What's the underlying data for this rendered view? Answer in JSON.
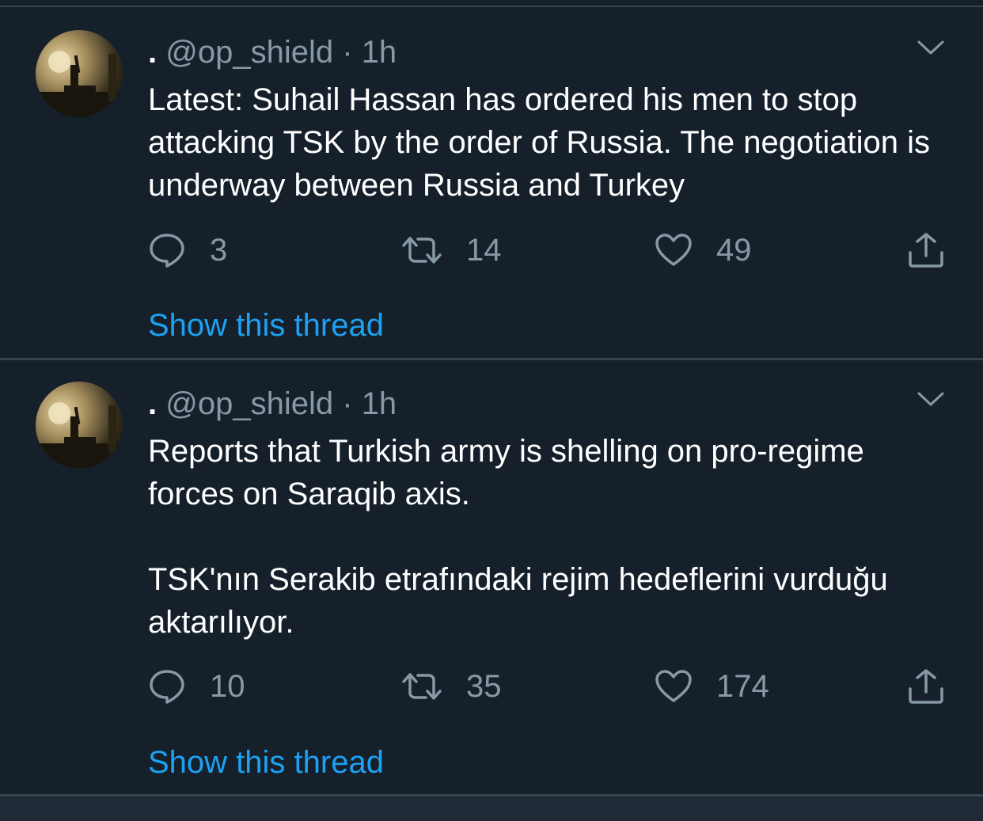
{
  "colors": {
    "background": "#15202b",
    "divider": "#38444d",
    "text": "#ffffff",
    "muted": "#8899a6",
    "link": "#1da1f2"
  },
  "tweets": [
    {
      "display_name": ".",
      "handle": "@op_shield",
      "separator": "·",
      "time": "1h",
      "text": [
        "Latest: Suhail Hassan has ordered his men to stop attacking TSK by the order of Russia. The negotiation is underway between Russia and Turkey"
      ],
      "replies": "3",
      "retweets": "14",
      "likes": "49",
      "show_thread": "Show this thread"
    },
    {
      "display_name": ".",
      "handle": "@op_shield",
      "separator": "·",
      "time": "1h",
      "text": [
        "Reports that Turkish army is shelling on pro-regime forces on Saraqib axis.",
        "TSK'nın Serakib etrafındaki rejim hedeflerini vurduğu aktarılıyor."
      ],
      "replies": "10",
      "retweets": "35",
      "likes": "174",
      "show_thread": "Show this thread"
    }
  ],
  "icons": {
    "reply": "reply-icon",
    "retweet": "retweet-icon",
    "like": "like-icon",
    "share": "share-icon",
    "more": "chevron-down-icon"
  }
}
